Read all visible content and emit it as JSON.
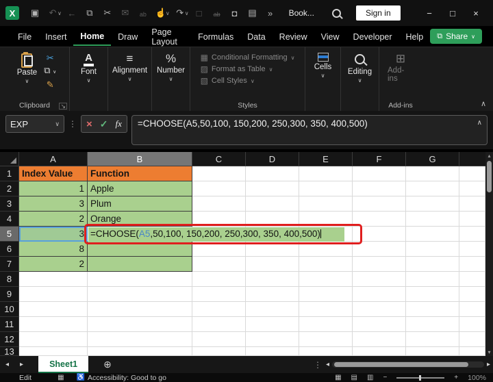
{
  "title_bar": {
    "document_title": "Book...",
    "sign_in_label": "Sign in"
  },
  "menu": {
    "tabs": [
      "File",
      "Insert",
      "Home",
      "Draw",
      "Page Layout",
      "Formulas",
      "Data",
      "Review",
      "View",
      "Developer",
      "Help"
    ],
    "share_label": "Share"
  },
  "ribbon": {
    "clipboard": {
      "paste": "Paste",
      "label": "Clipboard"
    },
    "font": {
      "label": "Font"
    },
    "alignment": {
      "label": "Alignment"
    },
    "number": {
      "label": "Number"
    },
    "styles": {
      "items": [
        "Conditional Formatting",
        "Format as Table",
        "Cell Styles"
      ],
      "label": "Styles"
    },
    "cells": {
      "label": "Cells"
    },
    "editing": {
      "label": "Editing"
    },
    "addins": {
      "button_label": "Add-ins",
      "label": "Add-ins"
    }
  },
  "formula_bar": {
    "name_box": "EXP",
    "fx_label": "fx",
    "formula": "=CHOOSE(A5,50,100, 150,200, 250,300, 350, 400,500)"
  },
  "sheet": {
    "col_headers": [
      "A",
      "B",
      "C",
      "D",
      "E",
      "F",
      "G"
    ],
    "selected_column": "B",
    "selected_row": "5",
    "rows": [
      {
        "n": "1",
        "a": "Index Value",
        "b": "Function"
      },
      {
        "n": "2",
        "a": "1",
        "b": "Apple"
      },
      {
        "n": "3",
        "a": "3",
        "b": "Plum"
      },
      {
        "n": "4",
        "a": "2",
        "b": "Orange"
      },
      {
        "n": "5",
        "a": "3"
      },
      {
        "n": "6",
        "a": "8",
        "b": ""
      },
      {
        "n": "7",
        "a": "2",
        "b": ""
      },
      {
        "n": "8"
      },
      {
        "n": "9"
      },
      {
        "n": "10"
      },
      {
        "n": "11"
      },
      {
        "n": "12"
      },
      {
        "n": "13"
      }
    ],
    "editing_cell": {
      "prefix": "=CHOOSE(",
      "ref": "A5",
      "suffix": ",50,100, 150,200, 250,300, 350, 400,500)"
    },
    "colors": {
      "header_fill": "#ED7D31",
      "data_fill": "#A9D08E",
      "annotation_border": "#E01E1E",
      "reference_highlight": "#58A0DC"
    }
  },
  "sheet_bar": {
    "active_tab": "Sheet1"
  },
  "status_bar": {
    "mode": "Edit",
    "accessibility": "Accessibility: Good to go",
    "zoom": "100%"
  },
  "icons": {
    "save": "▣",
    "undo": "↶",
    "back": "←",
    "copy_qat": "⧉",
    "cut_qat": "✂",
    "mail": "✉",
    "spelling": "ab",
    "touch": "☝",
    "redo": "↷",
    "new_file": "□",
    "strike": "ab",
    "camera": "◘",
    "lookup": "▤",
    "more": "»",
    "chevron_down": "∨",
    "chevron_up": "∧",
    "dots_v": "⋮",
    "launcher": "↘",
    "scissors": "✂",
    "copy": "⧉",
    "brush": "✎",
    "align": "≡",
    "percent": "%",
    "font_a": "A",
    "styles_cf": "▦",
    "styles_table": "▨",
    "styles_cell": "▧",
    "addins": "⊞",
    "cancel": "×",
    "check": "✓",
    "minimize": "−",
    "maximize": "□",
    "close": "×",
    "left_small": "◂",
    "right_small": "▸",
    "up_small": "▴",
    "down_small": "▾",
    "plus_circle": "⊕",
    "minus": "−",
    "plus": "+",
    "view_normal": "▦",
    "view_layout": "▤",
    "view_break": "▥",
    "macro": "▦",
    "accessibility": "♿",
    "share_box": "⧉"
  }
}
